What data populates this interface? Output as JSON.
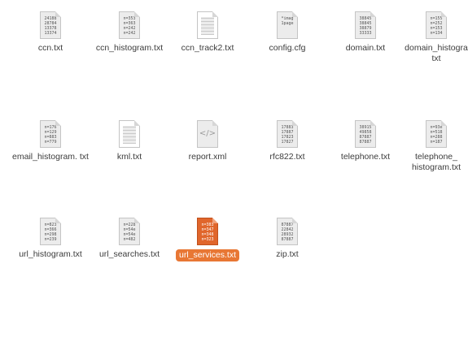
{
  "files": [
    {
      "name": "ccn.txt",
      "kind": "data",
      "preview": "24188\n28784\n13378\n13374"
    },
    {
      "name": "ccn_histogram.txt",
      "kind": "data",
      "preview": "n=353\nn=363\nn=242\nn=242"
    },
    {
      "name": "ccn_track2.txt",
      "kind": "lines",
      "preview": ""
    },
    {
      "name": "config.cfg",
      "kind": "data",
      "preview": "*imag\n1page"
    },
    {
      "name": "domain.txt",
      "kind": "data",
      "preview": "38845\n38845\n38879\n33333"
    },
    {
      "name": "domain_histogra txt",
      "kind": "data",
      "preview": "n=155\nn=252\nn=153\nn=134"
    },
    {
      "name": "email_histogram. txt",
      "kind": "data",
      "preview": "n=176\nn=129\nn=883\nn=779"
    },
    {
      "name": "kml.txt",
      "kind": "lines",
      "preview": ""
    },
    {
      "name": "report.xml",
      "kind": "code",
      "preview": "",
      "glyph": "</>"
    },
    {
      "name": "rfc822.txt",
      "kind": "data",
      "preview": "17883\n17887\n17823\n17827"
    },
    {
      "name": "telephone.txt",
      "kind": "data",
      "preview": "38915\n49858\n87887\n87887"
    },
    {
      "name": "telephone_ histogram.txt",
      "kind": "data",
      "preview": "n=93e\nn=518\nn=288\nn=187"
    },
    {
      "name": "url_histogram.txt",
      "kind": "data",
      "preview": "n=823\nn=366\nn=298\nn=239"
    },
    {
      "name": "url_searches.txt",
      "kind": "data",
      "preview": "n=228\nn=54e\nn=54e\nn=482"
    },
    {
      "name": "url_services.txt",
      "kind": "data",
      "preview": "n=383\nn=347\nn=348\nn=323",
      "selected": true
    },
    {
      "name": "zip.txt",
      "kind": "data",
      "preview": "87887\n22842\n28932\n87887"
    }
  ],
  "colors": {
    "selection": "#e87734",
    "selected_icon": "#e0662c"
  }
}
